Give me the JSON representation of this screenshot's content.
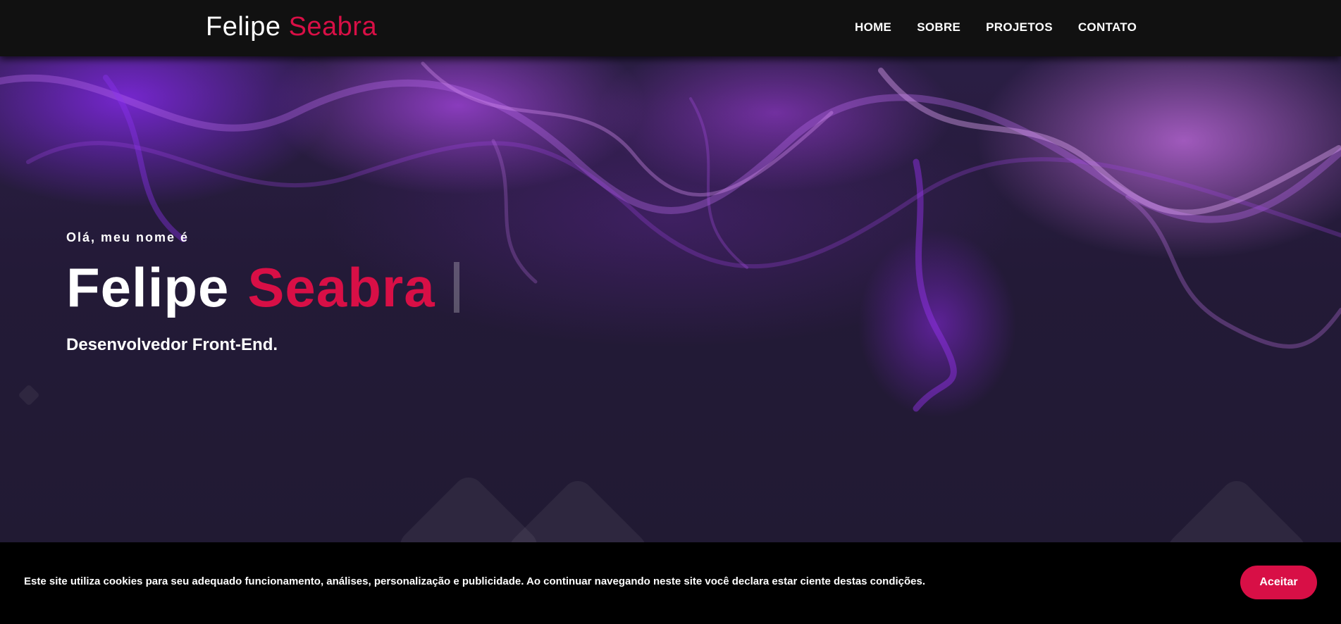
{
  "brand": {
    "first": "Felipe",
    "last": "Seabra",
    "accent_color": "#d80f46"
  },
  "nav": {
    "items": [
      {
        "label": "HOME"
      },
      {
        "label": "SOBRE"
      },
      {
        "label": "PROJETOS"
      },
      {
        "label": "CONTATO"
      }
    ]
  },
  "hero": {
    "greeting": "Olá, meu nome é",
    "first_name": "Felipe",
    "last_name": "Seabra",
    "role": "Desenvolvedor Front-End."
  },
  "cookie": {
    "text": "Este site utiliza cookies para seu adequado funcionamento, análises, personalização e publicidade. Ao continuar navegando neste site você declara estar ciente destas condições.",
    "accept_label": "Aceitar"
  }
}
